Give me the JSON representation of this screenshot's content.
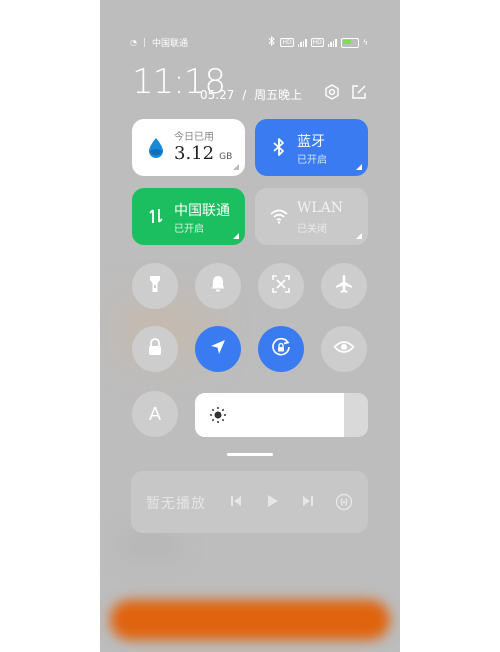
{
  "status_bar": {
    "carrier": "中国联通",
    "network_badges": [
      "HD",
      "HD"
    ],
    "battery_color": "#7ce04a"
  },
  "header": {
    "time": "11:18",
    "date": "05.27",
    "separator": "/",
    "weekday": "周五晚上",
    "icons": [
      "settings-icon",
      "edit-icon"
    ]
  },
  "tiles": {
    "data": {
      "label": "今日已用",
      "value": "3.12",
      "unit": "GB",
      "bg": "#ffffff",
      "accent": "#1a8ad6"
    },
    "bluetooth": {
      "title": "蓝牙",
      "status": "已开启",
      "bg": "#3a7bf2"
    },
    "mobile": {
      "title": "中国联通",
      "status": "已开启",
      "bg": "#1bbf60"
    },
    "wlan": {
      "title": "WLAN",
      "status": "已关闭",
      "bg": "#c9c9c9"
    }
  },
  "toggles_row1": [
    "flashlight-icon",
    "bell-icon",
    "screenshot-icon",
    "airplane-icon"
  ],
  "toggles_row2": [
    "lock-icon",
    "location-icon",
    "rotation-lock-icon",
    "eye-icon"
  ],
  "auto_brightness_label": "A",
  "brightness_level": 0.86,
  "media": {
    "label": "暂无播放",
    "controls": [
      "previous-icon",
      "play-icon",
      "next-icon",
      "cast-icon"
    ]
  }
}
